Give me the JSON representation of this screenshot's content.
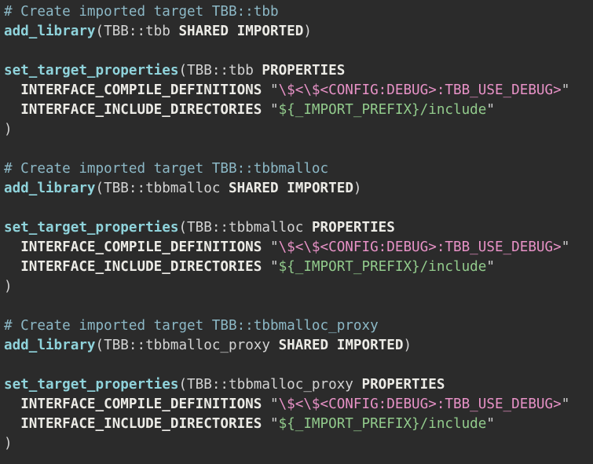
{
  "lines": [
    {
      "kind": "comment",
      "text": "# Create imported target TBB::tbb"
    },
    {
      "kind": "add_library",
      "func": "add_library",
      "open": "(",
      "target": "TBB::tbb",
      "kw1": "SHARED",
      "kw2": "IMPORTED",
      "close": ")"
    },
    {
      "kind": "blank"
    },
    {
      "kind": "set_props",
      "func": "set_target_properties",
      "open": "(",
      "target": "TBB::tbb",
      "kw": "PROPERTIES"
    },
    {
      "kind": "prop",
      "indent": "  ",
      "name": "INTERFACE_COMPILE_DEFINITIONS",
      "q1": "\"",
      "value": "\\$<\\$<CONFIG:DEBUG>:TBB_USE_DEBUG>",
      "q2": "\"",
      "color": "pink"
    },
    {
      "kind": "prop",
      "indent": "  ",
      "name": "INTERFACE_INCLUDE_DIRECTORIES",
      "q1": "\"",
      "value": "${_IMPORT_PREFIX}/include",
      "q2": "\"",
      "color": "green"
    },
    {
      "kind": "close",
      "text": ")"
    },
    {
      "kind": "blank"
    },
    {
      "kind": "comment",
      "text": "# Create imported target TBB::tbbmalloc"
    },
    {
      "kind": "add_library",
      "func": "add_library",
      "open": "(",
      "target": "TBB::tbbmalloc",
      "kw1": "SHARED",
      "kw2": "IMPORTED",
      "close": ")"
    },
    {
      "kind": "blank"
    },
    {
      "kind": "set_props",
      "func": "set_target_properties",
      "open": "(",
      "target": "TBB::tbbmalloc",
      "kw": "PROPERTIES"
    },
    {
      "kind": "prop",
      "indent": "  ",
      "name": "INTERFACE_COMPILE_DEFINITIONS",
      "q1": "\"",
      "value": "\\$<\\$<CONFIG:DEBUG>:TBB_USE_DEBUG>",
      "q2": "\"",
      "color": "pink"
    },
    {
      "kind": "prop",
      "indent": "  ",
      "name": "INTERFACE_INCLUDE_DIRECTORIES",
      "q1": "\"",
      "value": "${_IMPORT_PREFIX}/include",
      "q2": "\"",
      "color": "green"
    },
    {
      "kind": "close",
      "text": ")"
    },
    {
      "kind": "blank"
    },
    {
      "kind": "comment",
      "text": "# Create imported target TBB::tbbmalloc_proxy"
    },
    {
      "kind": "add_library",
      "func": "add_library",
      "open": "(",
      "target": "TBB::tbbmalloc_proxy",
      "kw1": "SHARED",
      "kw2": "IMPORTED",
      "close": ")"
    },
    {
      "kind": "blank"
    },
    {
      "kind": "set_props",
      "func": "set_target_properties",
      "open": "(",
      "target": "TBB::tbbmalloc_proxy",
      "kw": "PROPERTIES"
    },
    {
      "kind": "prop",
      "indent": "  ",
      "name": "INTERFACE_COMPILE_DEFINITIONS",
      "q1": "\"",
      "value": "\\$<\\$<CONFIG:DEBUG>:TBB_USE_DEBUG>",
      "q2": "\"",
      "color": "pink"
    },
    {
      "kind": "prop",
      "indent": "  ",
      "name": "INTERFACE_INCLUDE_DIRECTORIES",
      "q1": "\"",
      "value": "${_IMPORT_PREFIX}/include",
      "q2": "\"",
      "color": "green"
    },
    {
      "kind": "close",
      "text": ")"
    }
  ]
}
